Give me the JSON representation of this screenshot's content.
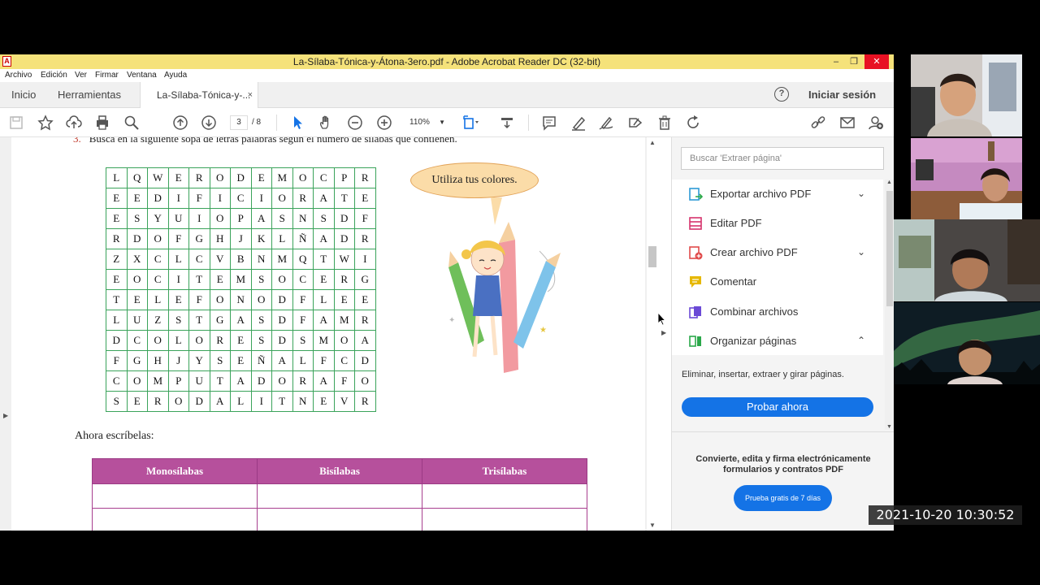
{
  "window": {
    "title": "La-Sílaba-Tónica-y-Átona-3ero.pdf - Adobe Acrobat Reader DC (32-bit)",
    "controls": {
      "minimize": "–",
      "maximize": "❐",
      "close": "✕"
    }
  },
  "menu": [
    "Archivo",
    "Edición",
    "Ver",
    "Firmar",
    "Ventana",
    "Ayuda"
  ],
  "tabs": {
    "home": "Inicio",
    "tools": "Herramientas",
    "document": "La-Sílaba-Tónica-y-...",
    "close": "×"
  },
  "header": {
    "help": "?",
    "signin": "Iniciar sesión"
  },
  "toolbar": {
    "page_current": "3",
    "page_total": "/ 8",
    "zoom": "110%"
  },
  "document": {
    "instruction_number": "3.",
    "instruction": "Busca en la siguiente sopa de letras palabras según el número de sílabas que contienen.",
    "bubble": "Utiliza tus colores.",
    "write_prompt": "Ahora escríbelas:",
    "word_search": [
      [
        "L",
        "Q",
        "W",
        "E",
        "R",
        "O",
        "D",
        "E",
        "M",
        "O",
        "C",
        "P",
        "R"
      ],
      [
        "E",
        "E",
        "D",
        "I",
        "F",
        "I",
        "C",
        "I",
        "O",
        "R",
        "A",
        "T",
        "E"
      ],
      [
        "E",
        "S",
        "Y",
        "U",
        "I",
        "O",
        "P",
        "A",
        "S",
        "N",
        "S",
        "D",
        "F"
      ],
      [
        "R",
        "D",
        "O",
        "F",
        "G",
        "H",
        "J",
        "K",
        "L",
        "Ñ",
        "A",
        "D",
        "R"
      ],
      [
        "Z",
        "X",
        "C",
        "L",
        "C",
        "V",
        "B",
        "N",
        "M",
        "Q",
        "T",
        "W",
        "I"
      ],
      [
        "E",
        "O",
        "C",
        "I",
        "T",
        "E",
        "M",
        "S",
        "O",
        "C",
        "E",
        "R",
        "G"
      ],
      [
        "T",
        "E",
        "L",
        "E",
        "F",
        "O",
        "N",
        "O",
        "D",
        "F",
        "L",
        "E",
        "E"
      ],
      [
        "L",
        "U",
        "Z",
        "S",
        "T",
        "G",
        "A",
        "S",
        "D",
        "F",
        "A",
        "M",
        "R"
      ],
      [
        "D",
        "C",
        "O",
        "L",
        "O",
        "R",
        "E",
        "S",
        "D",
        "S",
        "M",
        "O",
        "A"
      ],
      [
        "F",
        "G",
        "H",
        "J",
        "Y",
        "S",
        "E",
        "Ñ",
        "A",
        "L",
        "F",
        "C",
        "D"
      ],
      [
        "C",
        "O",
        "M",
        "P",
        "U",
        "T",
        "A",
        "D",
        "O",
        "R",
        "A",
        "F",
        "O"
      ],
      [
        "S",
        "E",
        "R",
        "O",
        "D",
        "A",
        "L",
        "I",
        "T",
        "N",
        "E",
        "V",
        "R"
      ]
    ],
    "syllable_table": {
      "headers": [
        "Monosílabas",
        "Bisílabas",
        "Trisílabas"
      ],
      "empty_rows": 2
    }
  },
  "right_pane": {
    "search_placeholder": "Buscar 'Extraer página'",
    "tools": [
      {
        "label": "Exportar archivo PDF",
        "chevron": "⌄",
        "color": "#2d9ad6"
      },
      {
        "label": "Editar PDF",
        "chevron": "",
        "color": "#d6336c"
      },
      {
        "label": "Crear archivo PDF",
        "chevron": "⌄",
        "color": "#e04a4a"
      },
      {
        "label": "Comentar",
        "chevron": "",
        "color": "#e6b800"
      },
      {
        "label": "Combinar archivos",
        "chevron": "",
        "color": "#6b4ad6"
      },
      {
        "label": "Organizar páginas",
        "chevron": "⌃",
        "color": "#2aa84a"
      }
    ],
    "tool_description": "Eliminar, insertar, extraer y girar páginas.",
    "try_button": "Probar ahora",
    "promo_line1": "Convierte, edita y firma electrónicamente",
    "promo_line2": "formularios y contratos PDF",
    "trial_button": "Prueba gratis de 7 días"
  },
  "timestamp": "2021-10-20 10:30:52",
  "colors": {
    "titlebar": "#f5e27a",
    "accent": "#1473e6",
    "grid": "#3aa35a",
    "table_header": "#b6509c"
  }
}
